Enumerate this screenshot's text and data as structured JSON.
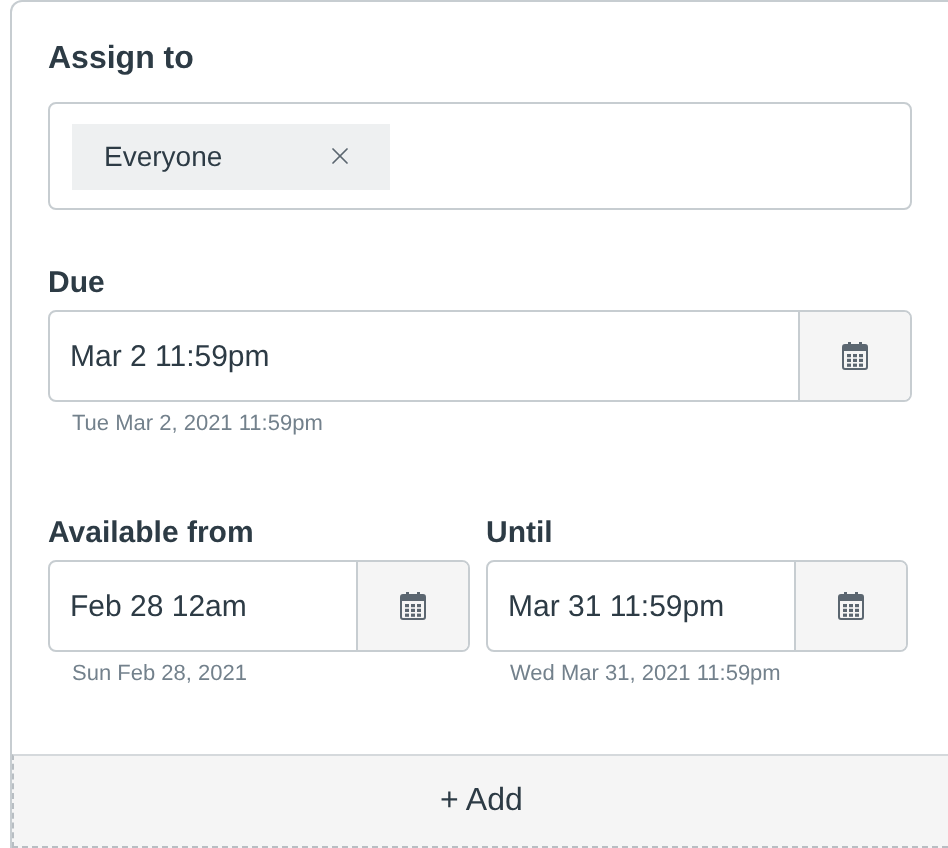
{
  "assign_to": {
    "label": "Assign to",
    "chips": [
      {
        "label": "Everyone"
      }
    ]
  },
  "due": {
    "label": "Due",
    "value": "Mar 2 11:59pm",
    "hint": "Tue Mar 2, 2021 11:59pm"
  },
  "availability": [
    {
      "label": "Available from",
      "value": "Feb 28 12am",
      "hint": "Sun Feb 28, 2021"
    },
    {
      "label": "Until",
      "value": "Mar 31 11:59pm",
      "hint": "Wed Mar 31, 2021 11:59pm"
    }
  ],
  "add_button": {
    "label": "+ Add"
  }
}
